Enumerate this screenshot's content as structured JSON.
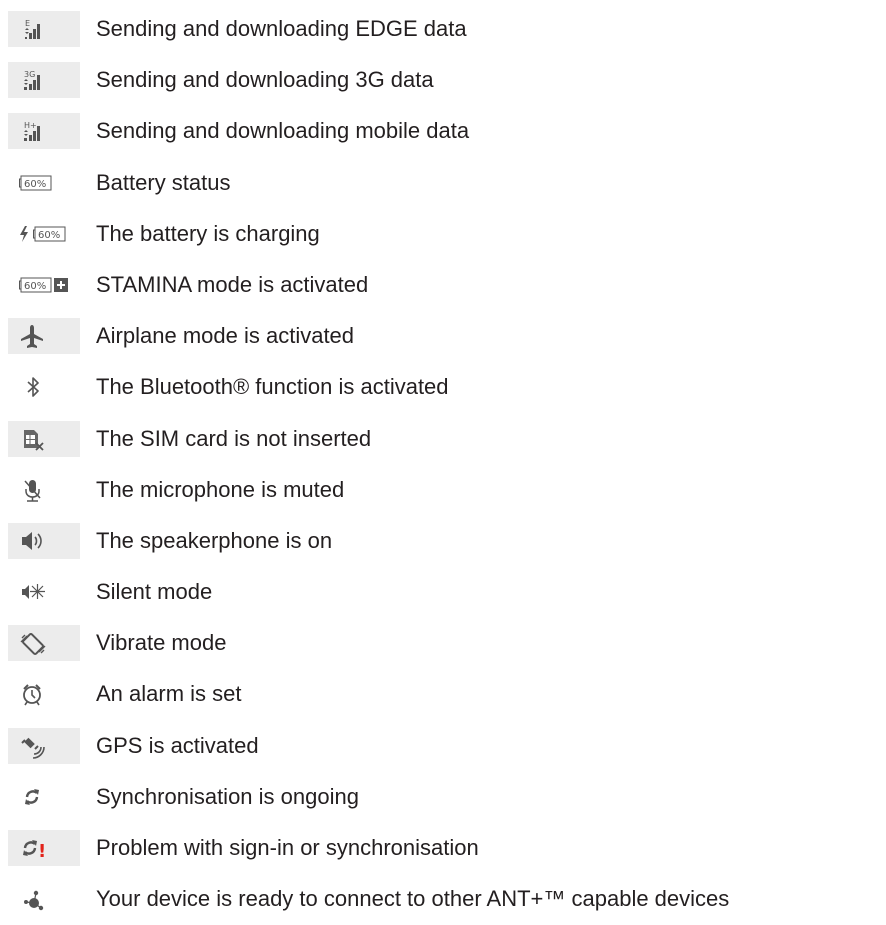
{
  "rows": [
    {
      "label": "Sending and downloading EDGE data",
      "icon": "edge-data-icon",
      "icon_text": "E"
    },
    {
      "label": "Sending and downloading 3G data",
      "icon": "3g-data-icon",
      "icon_text": "3G"
    },
    {
      "label": "Sending and downloading mobile data",
      "icon": "mobile-data-icon",
      "icon_text": "H+"
    },
    {
      "label": "Battery status",
      "icon": "battery-icon",
      "icon_text": "60%"
    },
    {
      "label": "The battery is charging",
      "icon": "battery-charging-icon",
      "icon_text": "60%"
    },
    {
      "label": "STAMINA mode is activated",
      "icon": "stamina-icon",
      "icon_text": "60%"
    },
    {
      "label": "Airplane mode is activated",
      "icon": "airplane-icon"
    },
    {
      "label": "The Bluetooth® function is activated",
      "icon": "bluetooth-icon"
    },
    {
      "label": "The SIM card is not inserted",
      "icon": "sim-missing-icon"
    },
    {
      "label": "The microphone is muted",
      "icon": "mic-muted-icon"
    },
    {
      "label": "The speakerphone is on",
      "icon": "speakerphone-icon"
    },
    {
      "label": "Silent mode",
      "icon": "silent-mode-icon"
    },
    {
      "label": "Vibrate mode",
      "icon": "vibrate-mode-icon"
    },
    {
      "label": "An alarm is set",
      "icon": "alarm-icon"
    },
    {
      "label": "GPS is activated",
      "icon": "gps-icon"
    },
    {
      "label": "Synchronisation is ongoing",
      "icon": "sync-icon"
    },
    {
      "label": "Problem with sign-in or synchronisation",
      "icon": "sync-problem-icon",
      "icon_text": "!"
    },
    {
      "label": "Your device is ready to connect  to other ANT+™ capable devices",
      "icon": "ant-plus-icon"
    }
  ],
  "colors": {
    "icon_box_bg": "#ececec",
    "icon_fg": "#555555",
    "warning": "#e2231a",
    "text": "#231f20"
  }
}
